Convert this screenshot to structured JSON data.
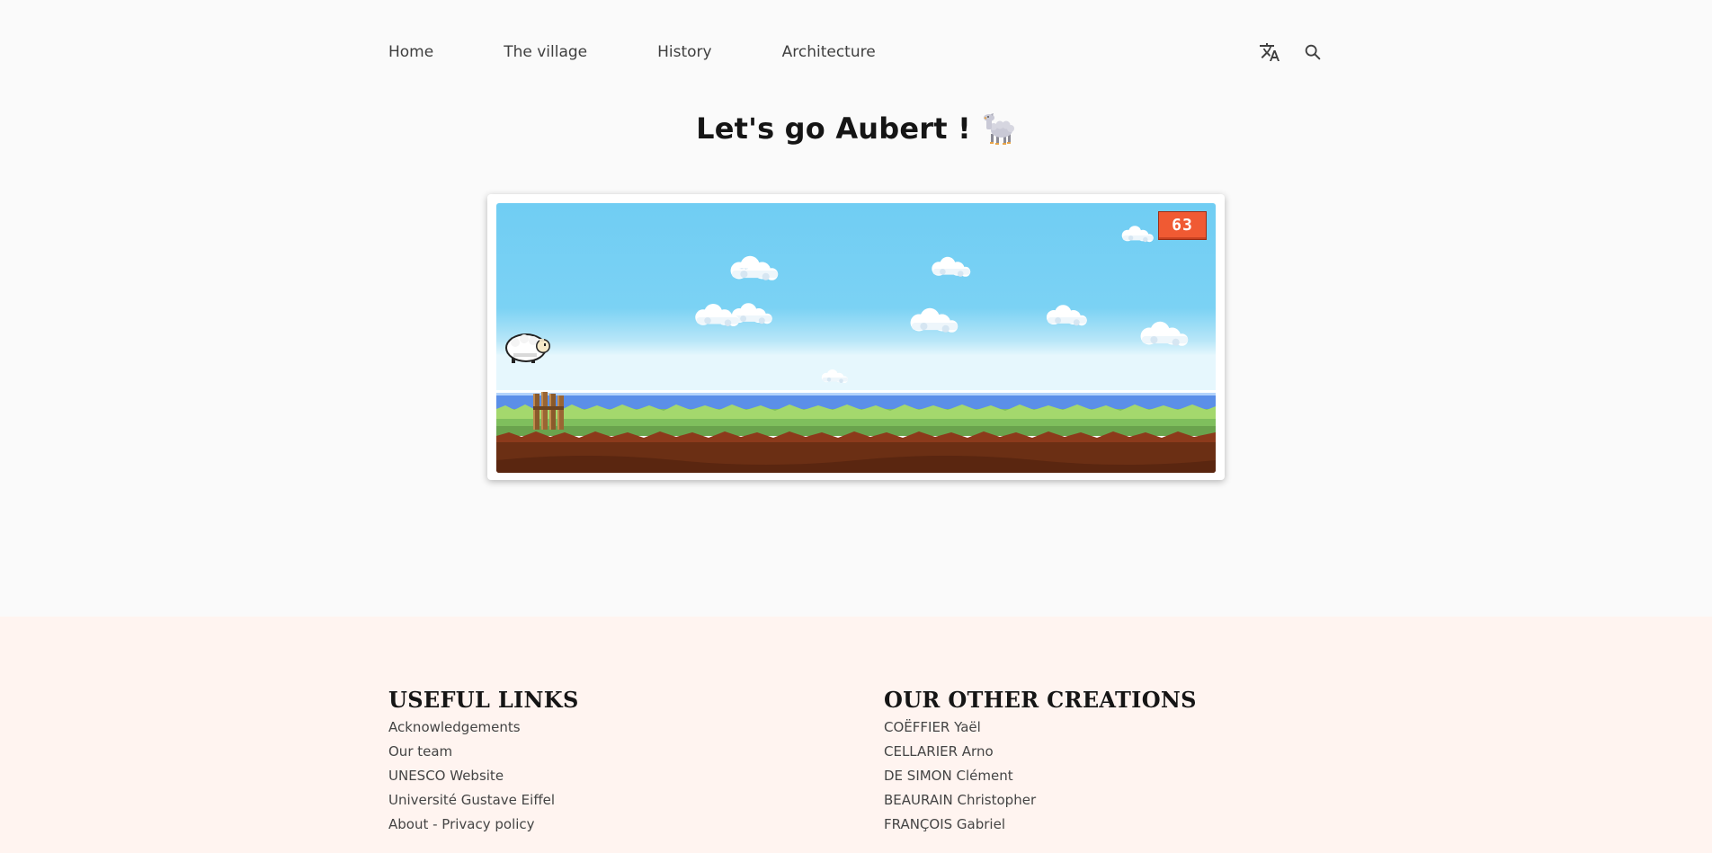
{
  "nav": {
    "items": [
      {
        "label": "Home"
      },
      {
        "label": "The village"
      },
      {
        "label": "History"
      },
      {
        "label": "Architecture"
      }
    ],
    "translate_icon": "translate-icon",
    "search_icon": "search-icon"
  },
  "page": {
    "title": "Let's go Aubert !",
    "title_icon": "sheep-icon"
  },
  "game": {
    "score": "63",
    "colors": {
      "sky": "#70cdf3",
      "water": "#5b8fe8",
      "grass": "#7fbf5d",
      "dirt": "#6b2f14",
      "score_badge": "#f05a33"
    },
    "sprites": [
      "sheep-player",
      "wooden-fence",
      "clouds"
    ]
  },
  "footer": {
    "useful_links": {
      "heading": "USEFUL LINKS",
      "items": [
        {
          "label": "Acknowledgements"
        },
        {
          "label": "Our team"
        },
        {
          "label": "UNESCO Website"
        },
        {
          "label": "Université Gustave Eiffel"
        },
        {
          "label": "About - Privacy policy"
        }
      ]
    },
    "other_creations": {
      "heading": "OUR OTHER CREATIONS",
      "items": [
        {
          "label": "COËFFIER Yaël"
        },
        {
          "label": "CELLARIER Arno"
        },
        {
          "label": "DE SIMON Clément"
        },
        {
          "label": "BEAURAIN Christopher"
        },
        {
          "label": "FRANÇOIS Gabriel"
        }
      ]
    }
  }
}
